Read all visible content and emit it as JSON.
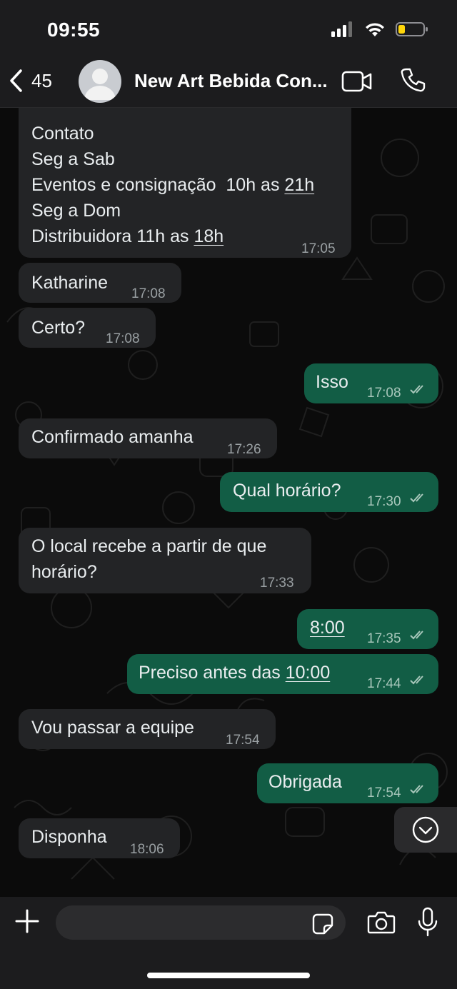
{
  "status_bar": {
    "time": "09:55"
  },
  "header": {
    "back_count": "45",
    "contact_name": "New Art Bebida Con..."
  },
  "messages": [
    {
      "dir": "in",
      "lines": [
        "Contato",
        "Seg a Sab",
        "Eventos e consignação  10h as 21h",
        "Seg a Dom",
        "Distribuidora 11h as 18h"
      ],
      "time": "17:05"
    },
    {
      "dir": "in",
      "text": "Katharine",
      "time": "17:08"
    },
    {
      "dir": "in",
      "text": "Certo?",
      "time": "17:08"
    },
    {
      "dir": "out",
      "text": "Isso",
      "time": "17:08"
    },
    {
      "dir": "in",
      "text": "Confirmado amanha",
      "time": "17:26"
    },
    {
      "dir": "out",
      "text": "Qual horário?",
      "time": "17:30"
    },
    {
      "dir": "in",
      "lines": [
        "O local recebe a partir de que",
        "horário?"
      ],
      "time": "17:33"
    },
    {
      "dir": "out",
      "text": "8:00",
      "time": "17:35"
    },
    {
      "dir": "out",
      "text": "Preciso antes das 10:00",
      "time": "17:44"
    },
    {
      "dir": "in",
      "text": "Vou passar a equipe",
      "time": "17:54"
    },
    {
      "dir": "out",
      "text": "Obrigada",
      "time": "17:54"
    },
    {
      "dir": "in",
      "text": "Disponha",
      "time": "18:06"
    }
  ],
  "composer": {
    "placeholder": ""
  },
  "colors": {
    "incoming": "#232426",
    "outgoing": "#125d45",
    "background": "#0b0b0b",
    "tick": "#a8c7bb"
  },
  "icons": [
    "back-chevron-icon",
    "avatar-icon",
    "video-call-icon",
    "phone-icon",
    "plus-icon",
    "sticker-icon",
    "camera-icon",
    "microphone-icon",
    "scroll-down-icon",
    "double-check-icon"
  ]
}
